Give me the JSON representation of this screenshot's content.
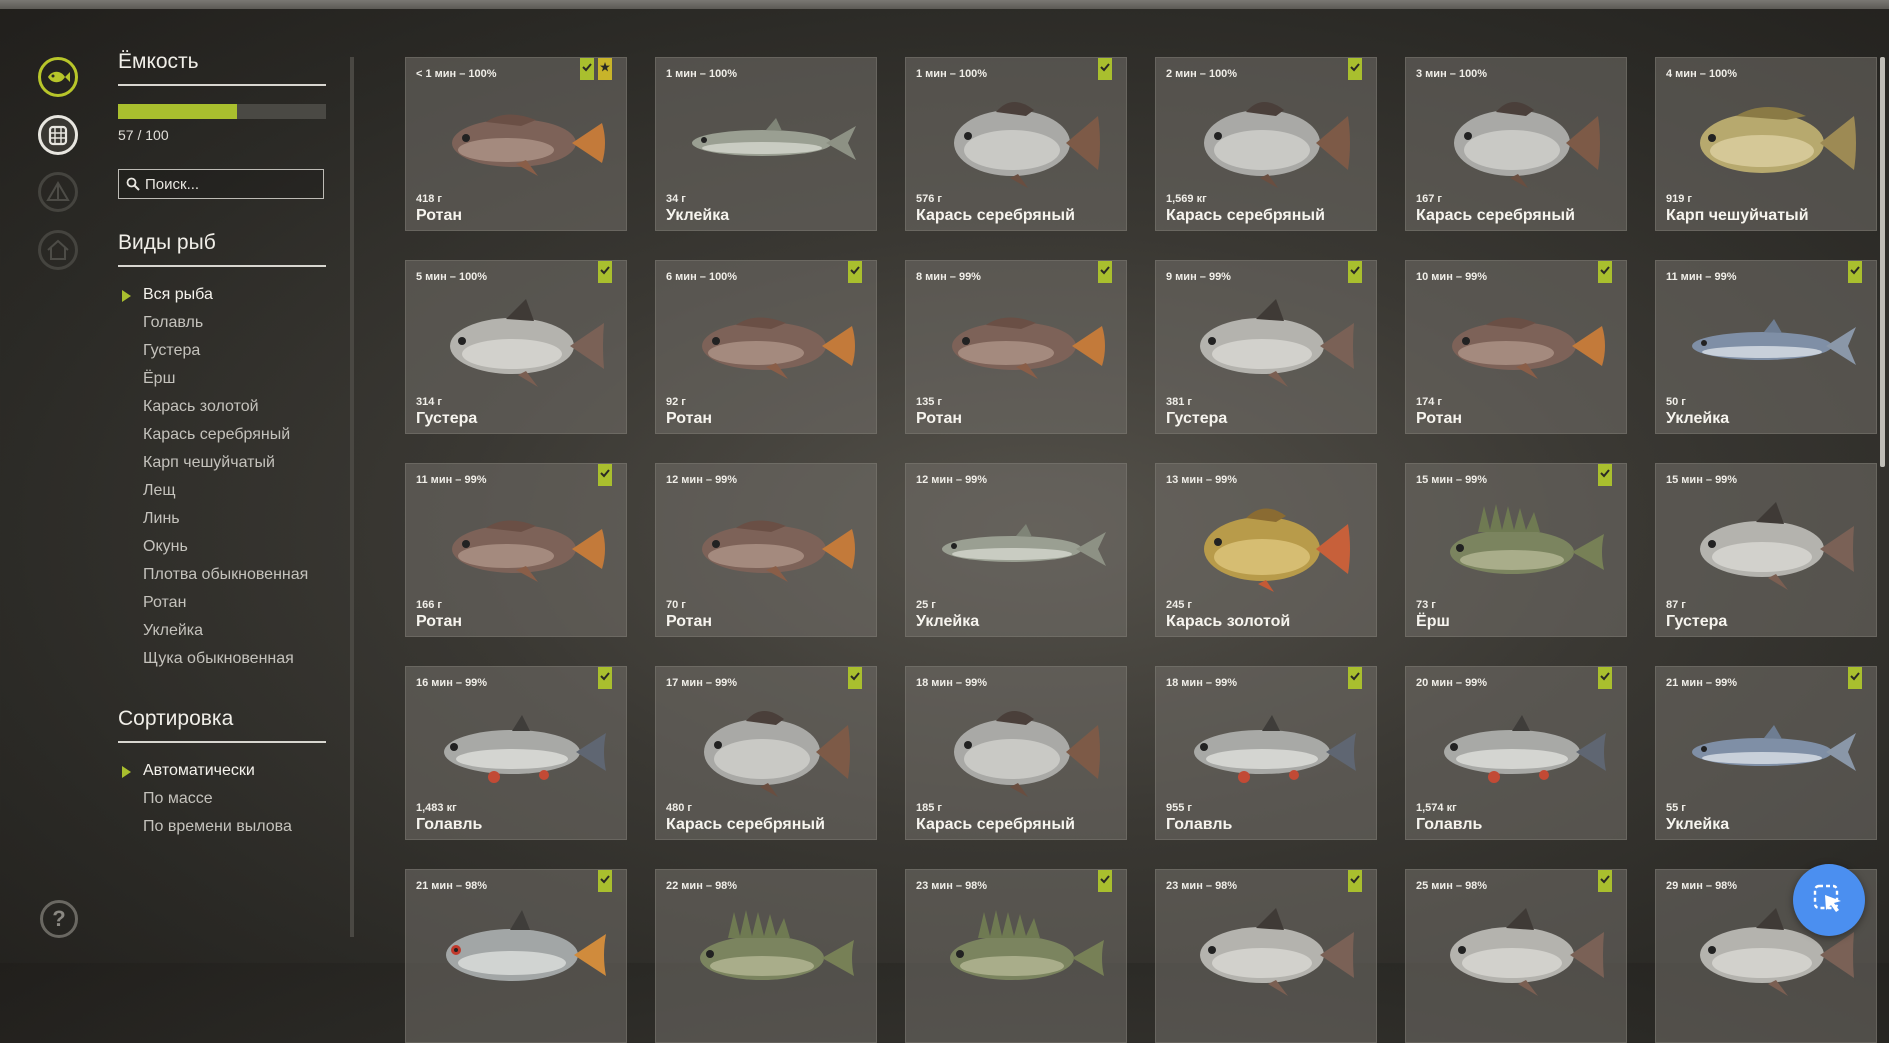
{
  "sidebar": {
    "capacity_title": "Ёмкость",
    "capacity_text": "57 / 100",
    "capacity_fraction": 0.57,
    "search_placeholder": "Поиск...",
    "species_title": "Виды рыб",
    "species": [
      {
        "label": "Вся рыба",
        "active": true
      },
      {
        "label": "Голавль",
        "active": false
      },
      {
        "label": "Густера",
        "active": false
      },
      {
        "label": "Ёрш",
        "active": false
      },
      {
        "label": "Карась золотой",
        "active": false
      },
      {
        "label": "Карась серебряный",
        "active": false
      },
      {
        "label": "Карп чешуйчатый",
        "active": false
      },
      {
        "label": "Лещ",
        "active": false
      },
      {
        "label": "Линь",
        "active": false
      },
      {
        "label": "Окунь",
        "active": false
      },
      {
        "label": "Плотва обыкновенная",
        "active": false
      },
      {
        "label": "Ротан",
        "active": false
      },
      {
        "label": "Уклейка",
        "active": false
      },
      {
        "label": "Щука обыкновенная",
        "active": false
      }
    ],
    "sort_title": "Сортировка",
    "sort_options": [
      {
        "label": "Автоматически",
        "active": true
      },
      {
        "label": "По массе",
        "active": false
      },
      {
        "label": "По времени вылова",
        "active": false
      }
    ]
  },
  "rail_icons": [
    "fish-icon",
    "keepnet-icon",
    "tent-icon",
    "home-icon",
    "help-icon"
  ],
  "colors": {
    "accent": "#a9bf2e",
    "star": "#c8b42a",
    "cursor_button": "#4b8ff0"
  },
  "fish": [
    {
      "time": "< 1 мин – 100%",
      "weight": "418 г",
      "name": "Ротан",
      "bookmark": true,
      "star": true,
      "kind": "rotan"
    },
    {
      "time": "1 мин – 100%",
      "weight": "34 г",
      "name": "Уклейка",
      "bookmark": false,
      "star": false,
      "kind": "bleak"
    },
    {
      "time": "1 мин – 100%",
      "weight": "576 г",
      "name": "Карась серебряный",
      "bookmark": true,
      "star": false,
      "kind": "crucian"
    },
    {
      "time": "2 мин – 100%",
      "weight": "1,569 кг",
      "name": "Карась серебряный",
      "bookmark": true,
      "star": false,
      "kind": "crucian"
    },
    {
      "time": "3 мин – 100%",
      "weight": "167 г",
      "name": "Карась серебряный",
      "bookmark": false,
      "star": false,
      "kind": "crucian"
    },
    {
      "time": "4 мин – 100%",
      "weight": "919 г",
      "name": "Карп чешуйчатый",
      "bookmark": false,
      "star": false,
      "kind": "carp"
    },
    {
      "time": "5 мин – 100%",
      "weight": "314 г",
      "name": "Густера",
      "bookmark": true,
      "star": false,
      "kind": "bream"
    },
    {
      "time": "6 мин – 100%",
      "weight": "92 г",
      "name": "Ротан",
      "bookmark": true,
      "star": false,
      "kind": "rotan"
    },
    {
      "time": "8 мин – 99%",
      "weight": "135 г",
      "name": "Ротан",
      "bookmark": true,
      "star": false,
      "kind": "rotan"
    },
    {
      "time": "9 мин – 99%",
      "weight": "381 г",
      "name": "Густера",
      "bookmark": true,
      "star": false,
      "kind": "bream"
    },
    {
      "time": "10 мин – 99%",
      "weight": "174 г",
      "name": "Ротан",
      "bookmark": true,
      "star": false,
      "kind": "rotan"
    },
    {
      "time": "11 мин – 99%",
      "weight": "50 г",
      "name": "Уклейка",
      "bookmark": true,
      "star": false,
      "kind": "bleakblue"
    },
    {
      "time": "11 мин – 99%",
      "weight": "166 г",
      "name": "Ротан",
      "bookmark": true,
      "star": false,
      "kind": "rotan"
    },
    {
      "time": "12 мин – 99%",
      "weight": "70 г",
      "name": "Ротан",
      "bookmark": false,
      "star": false,
      "kind": "rotan"
    },
    {
      "time": "12 мин – 99%",
      "weight": "25 г",
      "name": "Уклейка",
      "bookmark": false,
      "star": false,
      "kind": "bleak"
    },
    {
      "time": "13 мин – 99%",
      "weight": "245 г",
      "name": "Карась золотой",
      "bookmark": false,
      "star": false,
      "kind": "goldcrucian"
    },
    {
      "time": "15 мин – 99%",
      "weight": "73 г",
      "name": "Ёрш",
      "bookmark": true,
      "star": false,
      "kind": "ruffe"
    },
    {
      "time": "15 мин – 99%",
      "weight": "87 г",
      "name": "Густера",
      "bookmark": false,
      "star": false,
      "kind": "bream"
    },
    {
      "time": "16 мин – 99%",
      "weight": "1,483 кг",
      "name": "Голавль",
      "bookmark": true,
      "star": false,
      "kind": "chub"
    },
    {
      "time": "17 мин – 99%",
      "weight": "480 г",
      "name": "Карась серебряный",
      "bookmark": true,
      "star": false,
      "kind": "crucian"
    },
    {
      "time": "18 мин – 99%",
      "weight": "185 г",
      "name": "Карась серебряный",
      "bookmark": false,
      "star": false,
      "kind": "crucian"
    },
    {
      "time": "18 мин – 99%",
      "weight": "955 г",
      "name": "Голавль",
      "bookmark": true,
      "star": false,
      "kind": "chub"
    },
    {
      "time": "20 мин – 99%",
      "weight": "1,574 кг",
      "name": "Голавль",
      "bookmark": true,
      "star": false,
      "kind": "chub"
    },
    {
      "time": "21 мин – 99%",
      "weight": "55 г",
      "name": "Уклейка",
      "bookmark": true,
      "star": false,
      "kind": "bleakblue"
    },
    {
      "time": "21 мин – 98%",
      "weight": "",
      "name": "",
      "bookmark": true,
      "star": false,
      "kind": "roach"
    },
    {
      "time": "22 мин – 98%",
      "weight": "",
      "name": "",
      "bookmark": false,
      "star": false,
      "kind": "ruffe"
    },
    {
      "time": "23 мин – 98%",
      "weight": "",
      "name": "",
      "bookmark": true,
      "star": false,
      "kind": "ruffe"
    },
    {
      "time": "23 мин – 98%",
      "weight": "",
      "name": "",
      "bookmark": true,
      "star": false,
      "kind": "bream"
    },
    {
      "time": "25 мин – 98%",
      "weight": "",
      "name": "",
      "bookmark": true,
      "star": false,
      "kind": "bream"
    },
    {
      "time": "29 мин – 98%",
      "weight": "",
      "name": "",
      "bookmark": false,
      "star": false,
      "kind": "bream"
    }
  ]
}
